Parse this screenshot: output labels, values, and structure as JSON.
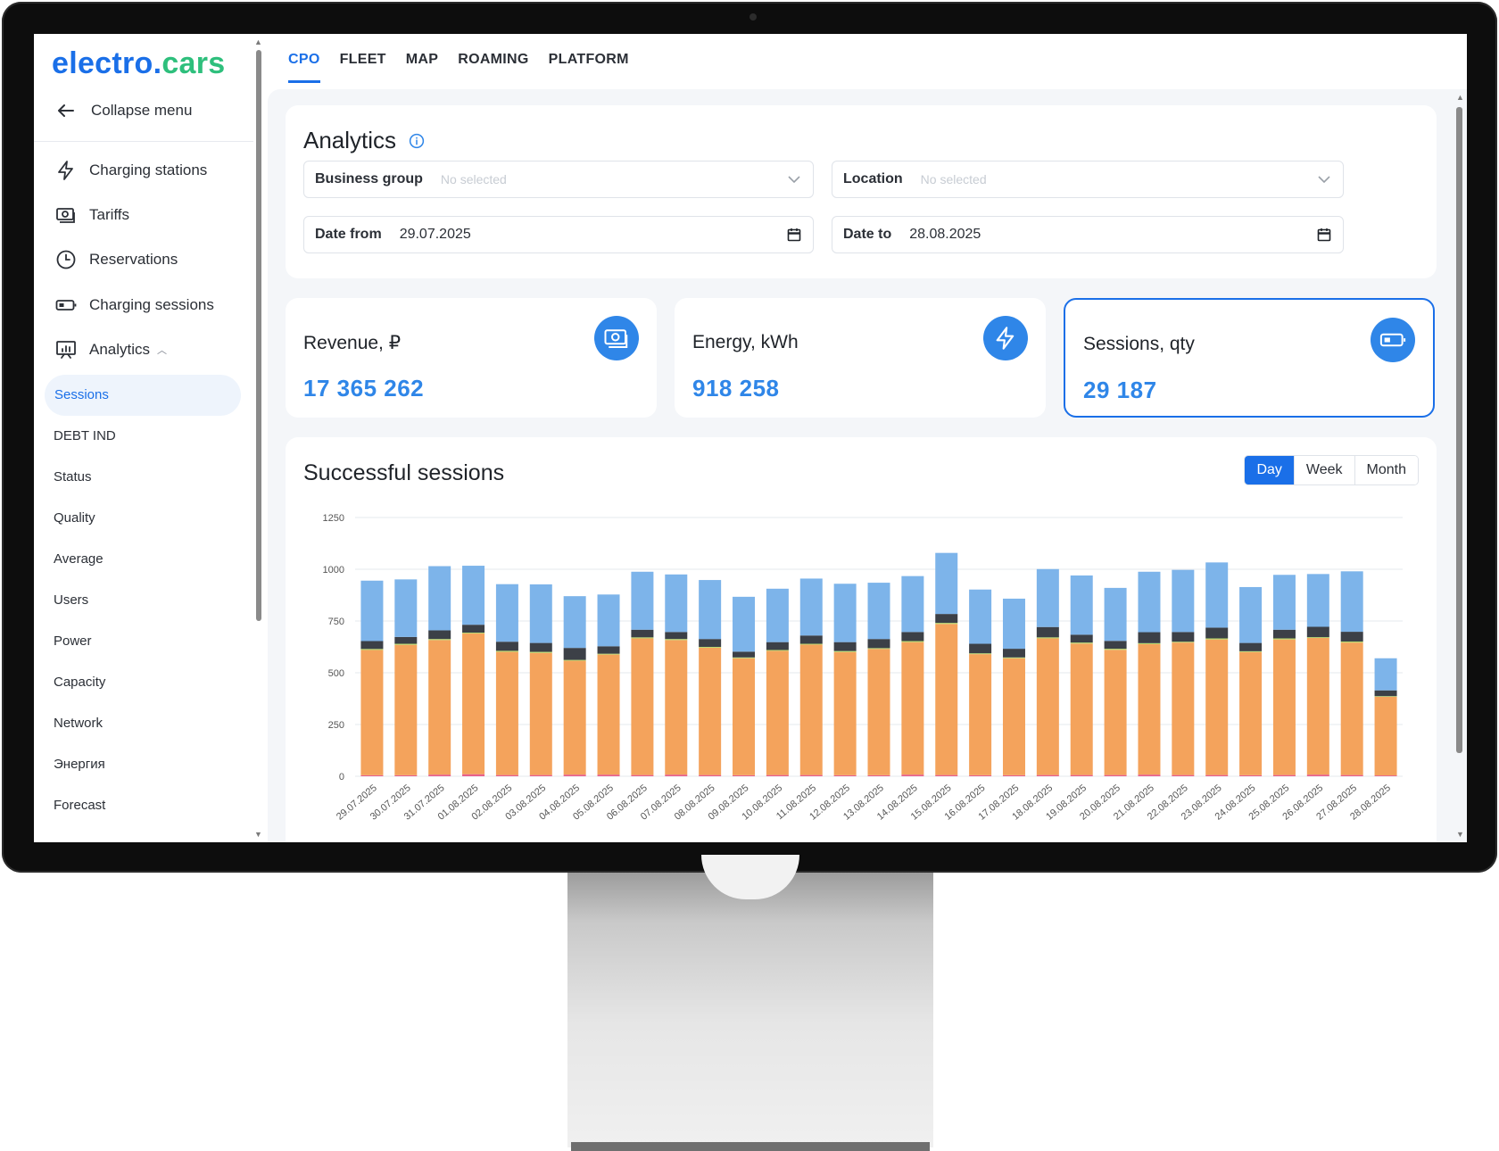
{
  "app": {
    "logo_part1": "electro.",
    "logo_part2": "cars",
    "accent_color": "#1a6fe8",
    "logo_green": "#2ebf7c"
  },
  "sidebar": {
    "collapse_label": "Collapse menu",
    "items": [
      {
        "label": "Charging stations",
        "icon": "lightning-icon"
      },
      {
        "label": "Tariffs",
        "icon": "money-icon"
      },
      {
        "label": "Reservations",
        "icon": "clock-icon"
      },
      {
        "label": "Charging sessions",
        "icon": "battery-icon"
      },
      {
        "label": "Analytics",
        "icon": "chart-board-icon",
        "expanded": true
      }
    ],
    "analytics_subitems": [
      "Sessions",
      "DEBT IND",
      "Status",
      "Quality",
      "Average",
      "Users",
      "Power",
      "Capacity",
      "Network",
      "Энергия",
      "Forecast"
    ],
    "active_subitem": "Sessions"
  },
  "tabs": [
    "CPO",
    "FLEET",
    "MAP",
    "ROAMING",
    "PLATFORM"
  ],
  "active_tab": "CPO",
  "filters": {
    "title": "Analytics",
    "business_group": {
      "label": "Business group",
      "placeholder": "No selected"
    },
    "location": {
      "label": "Location",
      "placeholder": "No selected"
    },
    "date_from": {
      "label": "Date from",
      "value": "29.07.2025"
    },
    "date_to": {
      "label": "Date to",
      "value": "28.08.2025"
    }
  },
  "stats": [
    {
      "label": "Revenue, ₽",
      "value": "17 365 262",
      "icon": "money-icon"
    },
    {
      "label": "Energy, kWh",
      "value": "918 258",
      "icon": "lightning-icon"
    },
    {
      "label": "Sessions, qty",
      "value": "29 187",
      "icon": "battery-icon",
      "selected": true
    }
  ],
  "chart": {
    "title": "Successful sessions",
    "periods": [
      "Day",
      "Week",
      "Month"
    ],
    "active_period": "Day"
  },
  "chart_data": {
    "type": "bar",
    "stacked": true,
    "ylim": [
      0,
      1250
    ],
    "yticks": [
      0,
      250,
      500,
      750,
      1000,
      1250
    ],
    "grid": true,
    "categories": [
      "29.07.2025",
      "30.07.2025",
      "31.07.2025",
      "01.08.2025",
      "02.08.2025",
      "03.08.2025",
      "04.08.2025",
      "05.08.2025",
      "06.08.2025",
      "07.08.2025",
      "08.08.2025",
      "09.08.2025",
      "10.08.2025",
      "11.08.2025",
      "12.08.2025",
      "13.08.2025",
      "14.08.2025",
      "15.08.2025",
      "16.08.2025",
      "17.08.2025",
      "18.08.2025",
      "19.08.2025",
      "20.08.2025",
      "21.08.2025",
      "22.08.2025",
      "23.08.2025",
      "24.08.2025",
      "25.08.2025",
      "26.08.2025",
      "27.08.2025",
      "28.08.2025"
    ],
    "series": [
      {
        "color": "#e8608a",
        "values": [
          5,
          5,
          8,
          10,
          6,
          6,
          8,
          8,
          6,
          8,
          6,
          5,
          6,
          6,
          5,
          5,
          8,
          6,
          5,
          5,
          6,
          6,
          6,
          8,
          6,
          6,
          5,
          6,
          8,
          6,
          4
        ]
      },
      {
        "color": "#f4a35c",
        "values": [
          605,
          630,
          650,
          680,
          595,
          590,
          550,
          580,
          660,
          650,
          615,
          565,
          600,
          630,
          595,
          610,
          640,
          730,
          585,
          565,
          660,
          635,
          605,
          630,
          640,
          655,
          595,
          655,
          660,
          640,
          380
        ]
      },
      {
        "color": "#b5d86b",
        "values": [
          5,
          5,
          5,
          4,
          5,
          5,
          4,
          4,
          5,
          5,
          4,
          4,
          4,
          4,
          5,
          4,
          5,
          5,
          4,
          4,
          5,
          5,
          5,
          5,
          4,
          5,
          4,
          5,
          4,
          5,
          3
        ]
      },
      {
        "color": "#3c4047",
        "values": [
          38,
          33,
          42,
          38,
          44,
          43,
          58,
          36,
          37,
          34,
          38,
          28,
          38,
          40,
          43,
          44,
          44,
          43,
          46,
          42,
          50,
          38,
          38,
          53,
          47,
          52,
          40,
          42,
          50,
          47,
          28
        ]
      },
      {
        "color": "#7db4ea",
        "values": [
          292,
          278,
          310,
          285,
          278,
          283,
          250,
          250,
          280,
          278,
          285,
          265,
          258,
          275,
          282,
          272,
          270,
          295,
          262,
          242,
          280,
          286,
          256,
          292,
          300,
          315,
          270,
          265,
          255,
          292,
          155
        ]
      }
    ]
  }
}
